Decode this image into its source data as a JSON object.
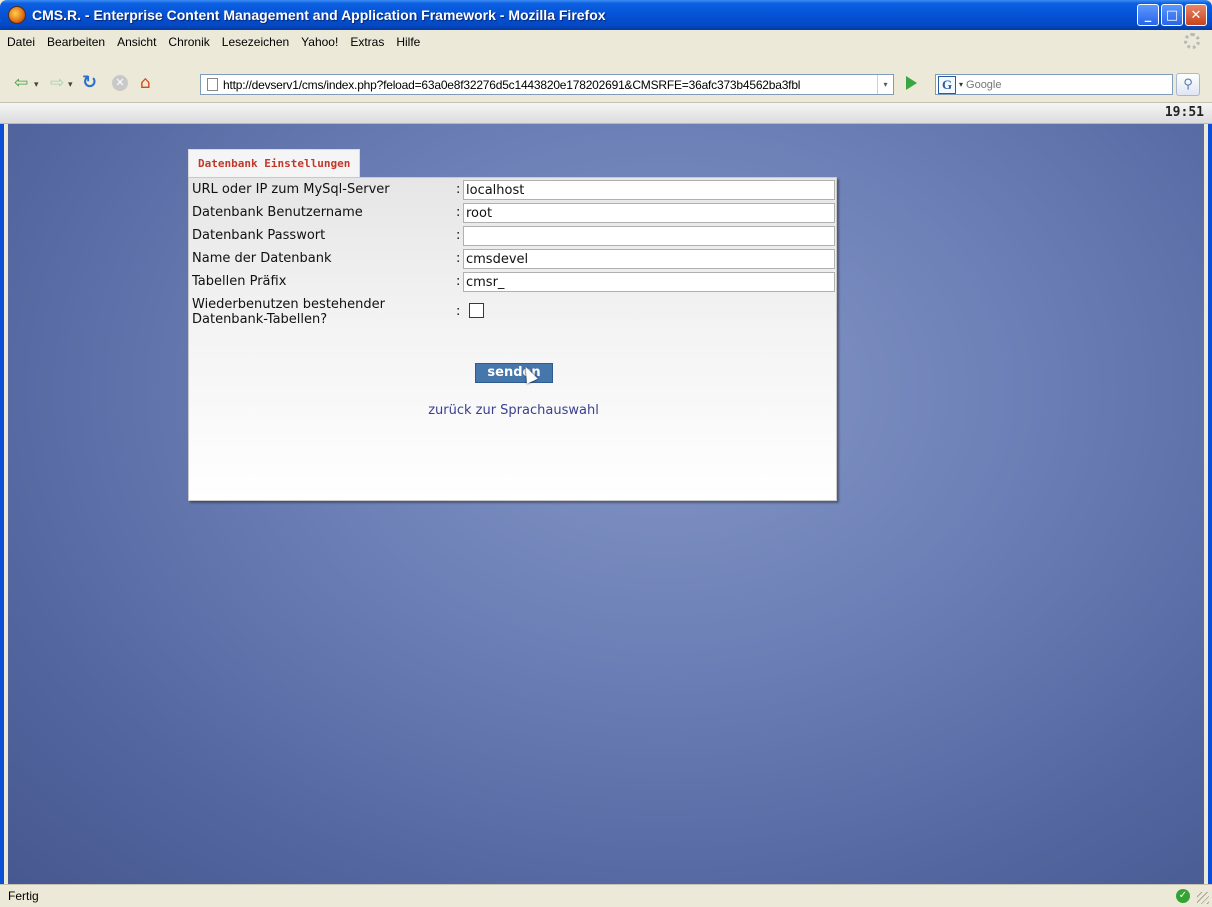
{
  "window": {
    "title": "CMS.R. - Enterprise Content Management and Application Framework - Mozilla Firefox",
    "minimize_glyph": "_",
    "maximize_glyph": "□",
    "close_glyph": "✕"
  },
  "menubar": {
    "items": [
      "Datei",
      "Bearbeiten",
      "Ansicht",
      "Chronik",
      "Lesezeichen",
      "Yahoo!",
      "Extras",
      "Hilfe"
    ]
  },
  "navbar": {
    "back_glyph": "⇦",
    "forward_glyph": "⇨",
    "dropdown_glyph": "▾",
    "reload_glyph": "↻",
    "stop_glyph": "✕",
    "home_glyph": "⌂",
    "url": "http://devserv1/cms/index.php?feload=63a0e8f32276d5c1443820e178202691&CMSRFE=36afc373b4562ba3fbl",
    "url_dropdown_glyph": "▾",
    "search_engine_letter": "G",
    "search_dropdown_glyph": "▾",
    "search_placeholder": "Google",
    "search_glyph": "⚲"
  },
  "clock": "19:51",
  "form": {
    "tab_title": "Datenbank Einstellungen",
    "rows": [
      {
        "label": "URL oder IP zum MySql-Server",
        "value": "localhost"
      },
      {
        "label": "Datenbank Benutzername",
        "value": "root"
      },
      {
        "label": "Datenbank Passwort",
        "value": ""
      },
      {
        "label": "Name der Datenbank",
        "value": "cmsdevel"
      },
      {
        "label": "Tabellen Präfix",
        "value": "cmsr_"
      }
    ],
    "reuse_label": "Wiederbenutzen bestehender Datenbank-Tabellen?",
    "reuse_checked": false,
    "colon": ":",
    "submit_label": "senden",
    "back_link": "zurück zur Sprachauswahl"
  },
  "status": {
    "text": "Fertig",
    "ok_glyph": "✓"
  }
}
